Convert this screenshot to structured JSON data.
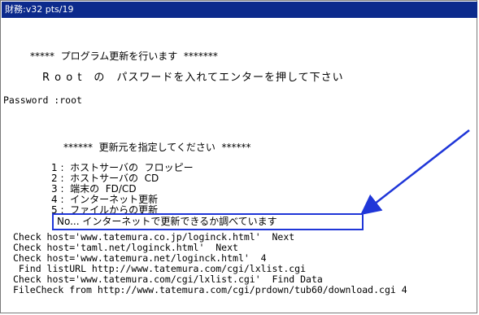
{
  "window": {
    "title": "財務:v32 pts/19"
  },
  "terminal": {
    "header1": "*****  プログラム更新を行います  *******",
    "header2": "R o o t　の　パスワードを入れてエンターを押して下さい",
    "password_label": "Password :root",
    "select_header": "******  更新元を指定してください  ******",
    "options": [
      "1 :  ホストサーバの  フロッピー",
      "2 :  ホストサーバの  CD",
      "3 :  端末の  FD/CD",
      "4 :  インターネット更新",
      "5 :  ファイルからの更新"
    ],
    "status": "No... インターネットで更新できるか調べています",
    "log": [
      "Check host='www.tatemura.co.jp/loginck.html'  Next",
      "Check host='taml.net/loginck.html'  Next",
      "Check host='www.tatemura.net/loginck.html'  4",
      " Find listURL http://www.tatemura.com/cgi/lxlist.cgi",
      "Check host='www.tatemura.com/cgi/lxlist.cgi'  Find Data",
      "FileCheck from http://www.tatemura.com/cgi/prdown/tub60/download.cgi 4"
    ]
  },
  "annotation": {
    "color": "#1f36d8"
  }
}
